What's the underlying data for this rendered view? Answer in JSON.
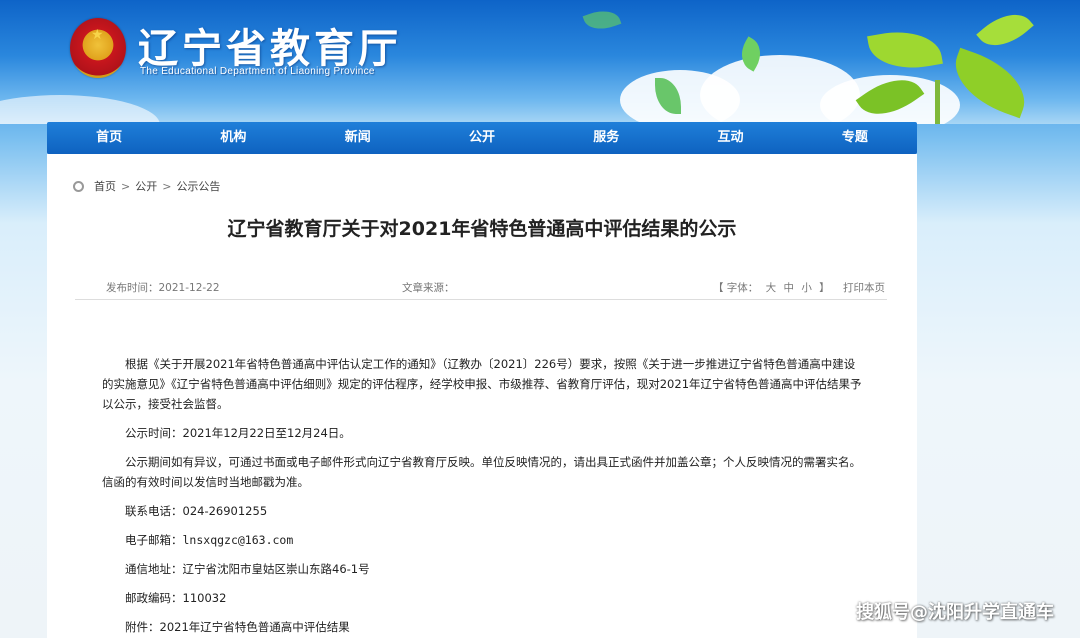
{
  "header": {
    "site_title": "辽宁省教育厅",
    "site_subtitle": "The Educational Department of Liaoning Province"
  },
  "nav": {
    "items": [
      "首页",
      "机构",
      "新闻",
      "公开",
      "服务",
      "互动",
      "专题"
    ]
  },
  "breadcrumb": {
    "home": "首页",
    "sep": ">",
    "level1": "公开",
    "level2": "公示公告"
  },
  "article": {
    "title": "辽宁省教育厅关于对2021年省特色普通高中评估结果的公示",
    "publish_label": "发布时间：",
    "publish_date": "2021-12-22",
    "source_label": "文章来源：",
    "font_label": "【 字体：",
    "font_large": "大",
    "font_medium": "中",
    "font_small": "小",
    "font_close": "】",
    "print": "打印本页",
    "para1": "根据《关于开展2021年省特色普通高中评估认定工作的通知》（辽教办〔2021〕226号）要求，按照《关于进一步推进辽宁省特色普通高中建设的实施意见》《辽宁省特色普通高中评估细则》规定的评估程序，经学校申报、市级推荐、省教育厅评估，现对2021年辽宁省特色普通高中评估结果予以公示，接受社会监督。",
    "para2": "公示时间：2021年12月22日至12月24日。",
    "para3": "公示期间如有异议，可通过书面或电子邮件形式向辽宁省教育厅反映。单位反映情况的，请出具正式函件并加盖公章；个人反映情况的需署实名。信函的有效时间以发信时当地邮戳为准。",
    "phone_label": "联系电话：",
    "phone": "024-26901255",
    "email_label": "电子邮箱：",
    "email": "lnsxqgzc@163.com",
    "address_label": "通信地址：",
    "address": "辽宁省沈阳市皇姑区崇山东路46-1号",
    "postcode_label": "邮政编码：",
    "postcode": "110032",
    "attachment_label": "附件：",
    "attachment": "2021年辽宁省特色普通高中评估结果"
  },
  "watermark": "搜狐号@沈阳升学直通车",
  "colors": {
    "nav_bg": "#0e62c0",
    "header_blue": "#1b7fd6",
    "title_text": "#222222"
  }
}
